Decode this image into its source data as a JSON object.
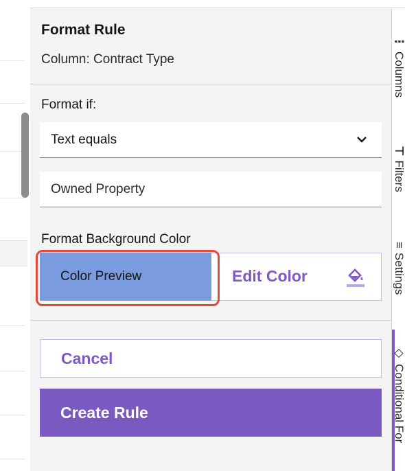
{
  "panel": {
    "title": "Format Rule",
    "subtitle": "Column: Contract Type",
    "format_if_label": "Format if:",
    "condition_value": "Text equals",
    "text_value": "Owned Property",
    "background_color_label": "Format Background Color",
    "color_preview_label": "Color Preview",
    "edit_color_label": "Edit Color",
    "cancel_label": "Cancel",
    "create_rule_label": "Create Rule"
  },
  "right_tabs": [
    {
      "label": "Columns",
      "icon": "columns-icon"
    },
    {
      "label": "Filters",
      "icon": "filter-icon"
    },
    {
      "label": "Settings",
      "icon": "settings-icon"
    },
    {
      "label": "Conditional For",
      "icon": "paint-icon"
    }
  ],
  "colors": {
    "accent": "#7a59c0",
    "preview_color": "#7a9be0",
    "highlight": "#e04b3a"
  }
}
